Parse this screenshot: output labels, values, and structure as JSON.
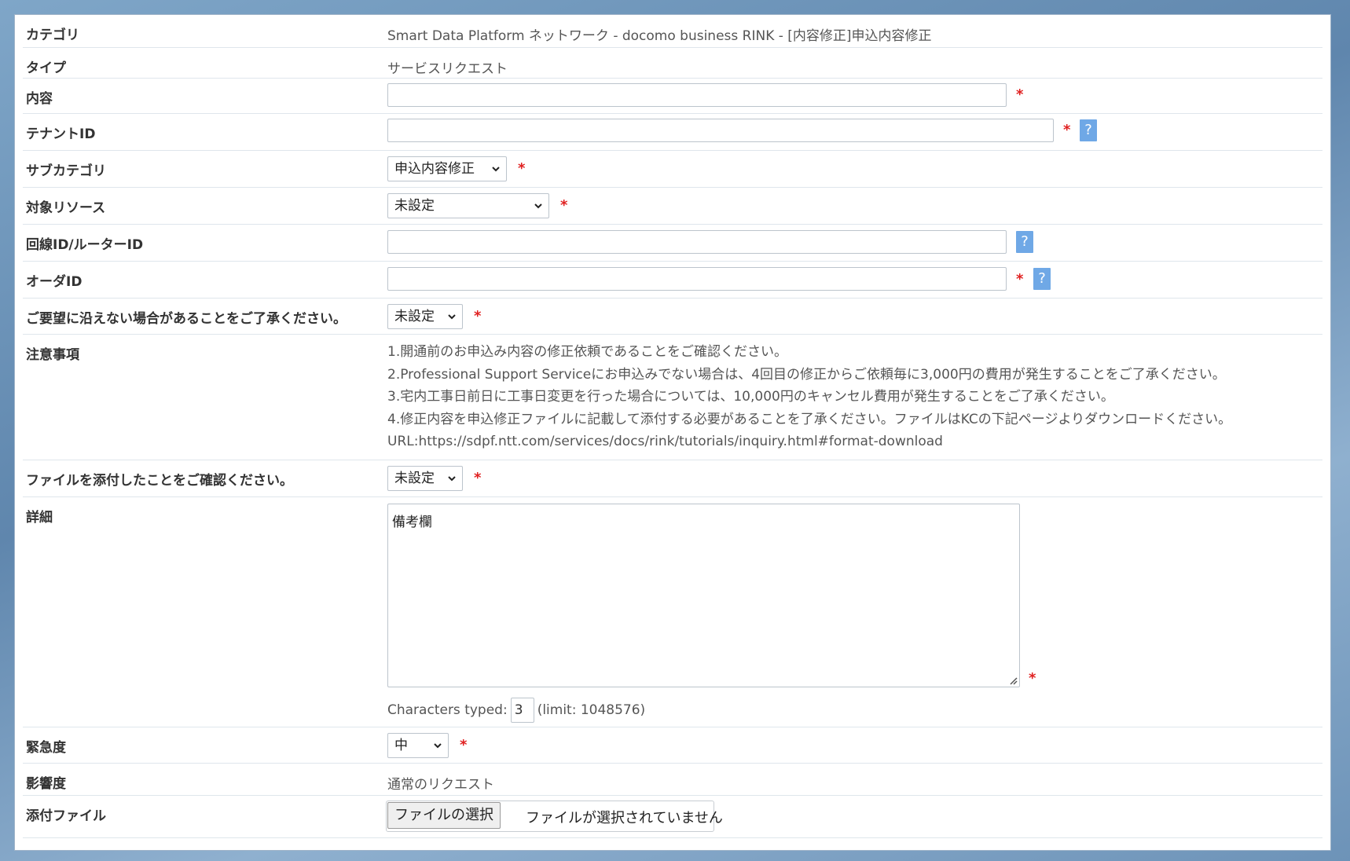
{
  "form": {
    "category": {
      "label": "カテゴリ",
      "value": "Smart Data Platform ネットワーク - docomo business RINK - [内容修正]申込内容修正"
    },
    "type": {
      "label": "タイプ",
      "value": "サービスリクエスト"
    },
    "content": {
      "label": "内容",
      "value": ""
    },
    "tenant_id": {
      "label": "テナントID",
      "value": ""
    },
    "subcategory": {
      "label": "サブカテゴリ",
      "selected": "申込内容修正"
    },
    "target_resource": {
      "label": "対象リソース",
      "selected": "未設定"
    },
    "line_router_id": {
      "label": "回線ID/ルーターID",
      "value": ""
    },
    "order_id": {
      "label": "オーダID",
      "value": ""
    },
    "acknowledge": {
      "label": "ご要望に沿えない場合があることをご了承ください。",
      "selected": "未設定"
    },
    "notes": {
      "label": "注意事項",
      "lines": [
        "1.開通前のお申込み内容の修正依頼であることをご確認ください。",
        "2.Professional Support Serviceにお申込みでない場合は、4回目の修正からご依頼毎に3,000円の費用が発生することをご了承ください。",
        "3.宅内工事日前日に工事日変更を行った場合については、10,000円のキャンセル費用が発生することをご了承ください。",
        "4.修正内容を申込修正ファイルに記載して添付する必要があることを了承ください。ファイルはKCの下記ページよりダウンロードください。",
        "URL:https://sdpf.ntt.com/services/docs/rink/tutorials/inquiry.html#format-download"
      ]
    },
    "file_confirm": {
      "label": "ファイルを添付したことをご確認ください。",
      "selected": "未設定"
    },
    "details": {
      "label": "詳細",
      "value": "備考欄",
      "chars_prefix": "Characters typed:",
      "chars_count": "3",
      "chars_limit": "(limit: 1048576)"
    },
    "urgency": {
      "label": "緊急度",
      "selected": "中"
    },
    "impact": {
      "label": "影響度",
      "value": "通常のリクエスト"
    },
    "attachment": {
      "label": "添付ファイル",
      "button": "ファイルの選択",
      "status": "ファイルが選択されていません"
    }
  },
  "required_mark": "*",
  "help_mark": "?",
  "colors": {
    "required": "#e02020",
    "help_bg": "#6fa8e6",
    "label": "#333333",
    "value": "#555555"
  }
}
